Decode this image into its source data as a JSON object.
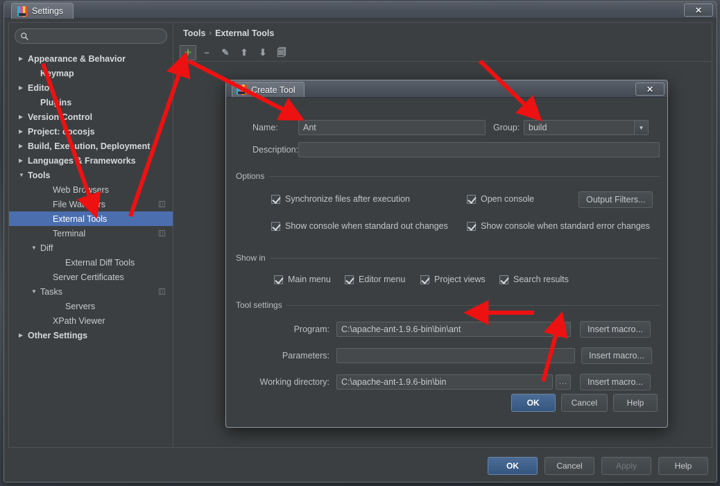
{
  "window": {
    "title": "Settings",
    "close_label": "✕",
    "logo_icon": "intellij-logo-icon"
  },
  "search": {
    "value": "",
    "placeholder": "",
    "icon": "search-icon"
  },
  "sidebar": {
    "items": [
      {
        "label": "Appearance & Behavior",
        "twisty": "▶",
        "indent": 1,
        "bold": true,
        "selected": false,
        "module_icon": false
      },
      {
        "label": "Keymap",
        "twisty": "",
        "indent": 2,
        "bold": true,
        "selected": false,
        "module_icon": false
      },
      {
        "label": "Editor",
        "twisty": "▶",
        "indent": 1,
        "bold": true,
        "selected": false,
        "module_icon": false
      },
      {
        "label": "Plugins",
        "twisty": "",
        "indent": 2,
        "bold": true,
        "selected": false,
        "module_icon": false
      },
      {
        "label": "Version Control",
        "twisty": "▶",
        "indent": 1,
        "bold": true,
        "selected": false,
        "module_icon": false
      },
      {
        "label": "Project: cocosjs",
        "twisty": "▶",
        "indent": 1,
        "bold": true,
        "selected": false,
        "module_icon": false
      },
      {
        "label": "Build, Execution, Deployment",
        "twisty": "▶",
        "indent": 1,
        "bold": true,
        "selected": false,
        "module_icon": false
      },
      {
        "label": "Languages & Frameworks",
        "twisty": "▶",
        "indent": 1,
        "bold": true,
        "selected": false,
        "module_icon": false
      },
      {
        "label": "Tools",
        "twisty": "▼",
        "indent": 1,
        "bold": true,
        "selected": false,
        "module_icon": false
      },
      {
        "label": "Web Browsers",
        "twisty": "",
        "indent": 3,
        "bold": false,
        "selected": false,
        "module_icon": false
      },
      {
        "label": "File Watchers",
        "twisty": "",
        "indent": 3,
        "bold": false,
        "selected": false,
        "module_icon": true
      },
      {
        "label": "External Tools",
        "twisty": "",
        "indent": 3,
        "bold": false,
        "selected": true,
        "module_icon": false
      },
      {
        "label": "Terminal",
        "twisty": "",
        "indent": 3,
        "bold": false,
        "selected": false,
        "module_icon": true
      },
      {
        "label": "Diff",
        "twisty": "▼",
        "indent": 2,
        "bold": false,
        "selected": false,
        "module_icon": false
      },
      {
        "label": "External Diff Tools",
        "twisty": "",
        "indent": 4,
        "bold": false,
        "selected": false,
        "module_icon": false
      },
      {
        "label": "Server Certificates",
        "twisty": "",
        "indent": 3,
        "bold": false,
        "selected": false,
        "module_icon": false
      },
      {
        "label": "Tasks",
        "twisty": "▼",
        "indent": 2,
        "bold": false,
        "selected": false,
        "module_icon": true
      },
      {
        "label": "Servers",
        "twisty": "",
        "indent": 4,
        "bold": false,
        "selected": false,
        "module_icon": false
      },
      {
        "label": "XPath Viewer",
        "twisty": "",
        "indent": 3,
        "bold": false,
        "selected": false,
        "module_icon": false
      },
      {
        "label": "Other Settings",
        "twisty": "▶",
        "indent": 1,
        "bold": true,
        "selected": false,
        "module_icon": false
      }
    ]
  },
  "breadcrumb": {
    "parent": "Tools",
    "separator": "›",
    "current": "External Tools"
  },
  "toolbar": {
    "buttons": [
      {
        "name": "add-button",
        "glyph": "+",
        "active": true,
        "color": "#6aa84f"
      },
      {
        "name": "remove-button",
        "glyph": "–",
        "active": false,
        "color": "#9aa0a4"
      },
      {
        "name": "edit-button",
        "glyph": "✎",
        "active": false,
        "color": "#9aa0a4"
      },
      {
        "name": "move-up-button",
        "glyph": "⬆",
        "active": false,
        "color": "#9aa0a4"
      },
      {
        "name": "move-down-button",
        "glyph": "⬇",
        "active": false,
        "color": "#9aa0a4"
      },
      {
        "name": "copy-button",
        "glyph": "🗐",
        "active": false,
        "color": "#9aa0a4"
      }
    ]
  },
  "window_buttons": {
    "ok": "OK",
    "cancel": "Cancel",
    "apply": "Apply",
    "help": "Help"
  },
  "dialog": {
    "title": "Create Tool",
    "close_label": "✕",
    "name_label": "Name:",
    "name_value": "Ant",
    "group_label": "Group:",
    "group_value": "build",
    "group_options": [
      "build"
    ],
    "description_label": "Description:",
    "description_value": "",
    "options_group_title": "Options",
    "options": [
      {
        "label": "Synchronize files after execution",
        "checked": true
      },
      {
        "label": "Open console",
        "checked": true
      },
      {
        "label": "Show console when standard out changes",
        "checked": true
      },
      {
        "label": "Show console when standard error changes",
        "checked": true
      }
    ],
    "output_filters_button": "Output Filters...",
    "showin_group_title": "Show in",
    "showin": [
      {
        "label": "Main menu",
        "checked": true
      },
      {
        "label": "Editor menu",
        "checked": true
      },
      {
        "label": "Project views",
        "checked": true
      },
      {
        "label": "Search results",
        "checked": true
      }
    ],
    "toolsettings_group_title": "Tool settings",
    "program_label": "Program:",
    "program_value": "C:\\apache-ant-1.9.6-bin\\bin\\ant",
    "parameters_label": "Parameters:",
    "parameters_value": "",
    "workdir_label": "Working directory:",
    "workdir_value": "C:\\apache-ant-1.9.6-bin\\bin",
    "browse_label": "...",
    "insert_macro_label": "Insert macro...",
    "insert_macro_mnemonic": "m",
    "ok": "OK",
    "cancel": "Cancel",
    "help": "Help"
  },
  "annotations": {
    "accent_color": "#ee1111",
    "arrow_count": 5
  }
}
